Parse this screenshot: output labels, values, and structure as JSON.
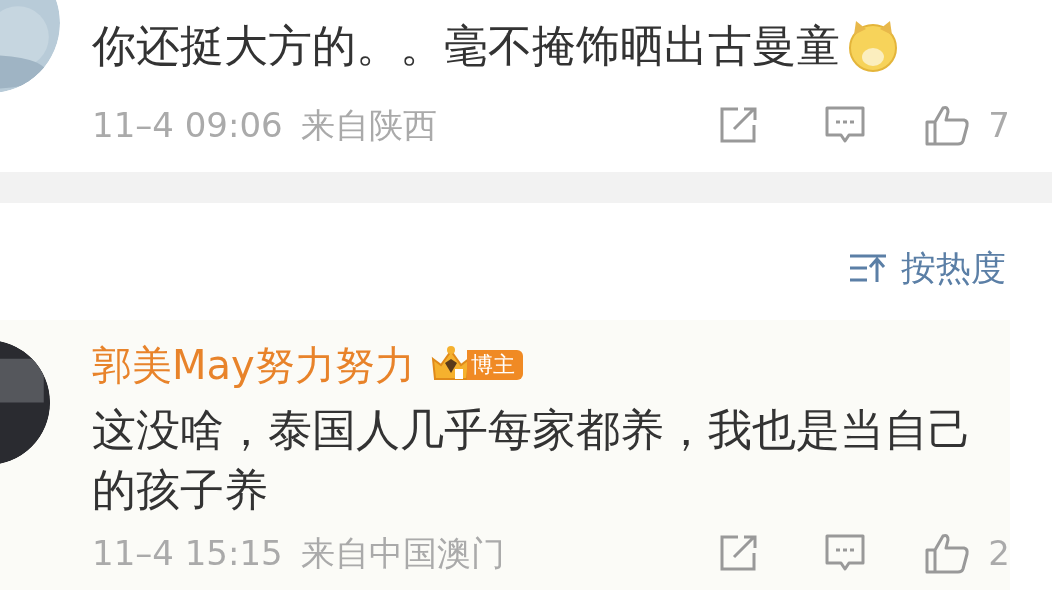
{
  "comments": [
    {
      "text": "你还挺大方的。。毫不掩饰晒出古曼童",
      "trailing_emoji": true,
      "time": "11–4 09:06",
      "location": "来自陕西",
      "likes": "7"
    },
    {
      "author": "郭美May努力努力",
      "badge": "博主",
      "text": "这没啥，泰国人几乎每家都养，我也是当自己的孩子养",
      "trailing_emoji": false,
      "time": "11–4 15:15",
      "location": "来自中国澳门",
      "likes": "2"
    }
  ],
  "sort": {
    "label": "按热度"
  }
}
